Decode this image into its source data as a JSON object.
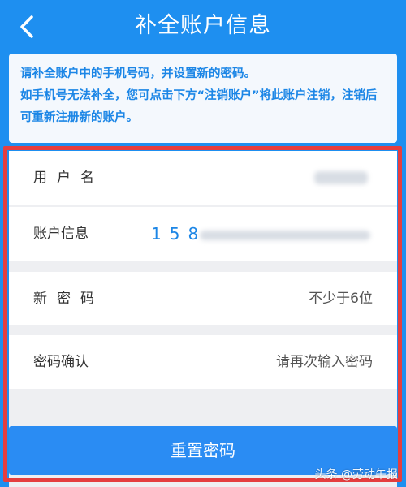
{
  "header": {
    "title": "补全账户信息",
    "back_icon": "chevron-left-icon"
  },
  "notice": {
    "line1": "请补全账户中的手机号码，并设置新的密码。",
    "line2": "如手机号无法补全，您可点击下方“注销账户”将此账户注销，注销后可重新注册新的账户。"
  },
  "form": {
    "username_label": "用户名",
    "account_info_label": "账户信息",
    "account_info_value": "158",
    "new_password_label": "新密码",
    "new_password_placeholder": "不少于6位",
    "confirm_password_label": "密码确认",
    "confirm_password_placeholder": "请再次输入密码"
  },
  "submit_button": "重置密码",
  "watermark": "头条 @劳动午报",
  "colors": {
    "primary": "#1e8ff0",
    "notice_text": "#1c86e6",
    "highlight_frame": "#e53e3f",
    "button": "#2a8cf3"
  }
}
